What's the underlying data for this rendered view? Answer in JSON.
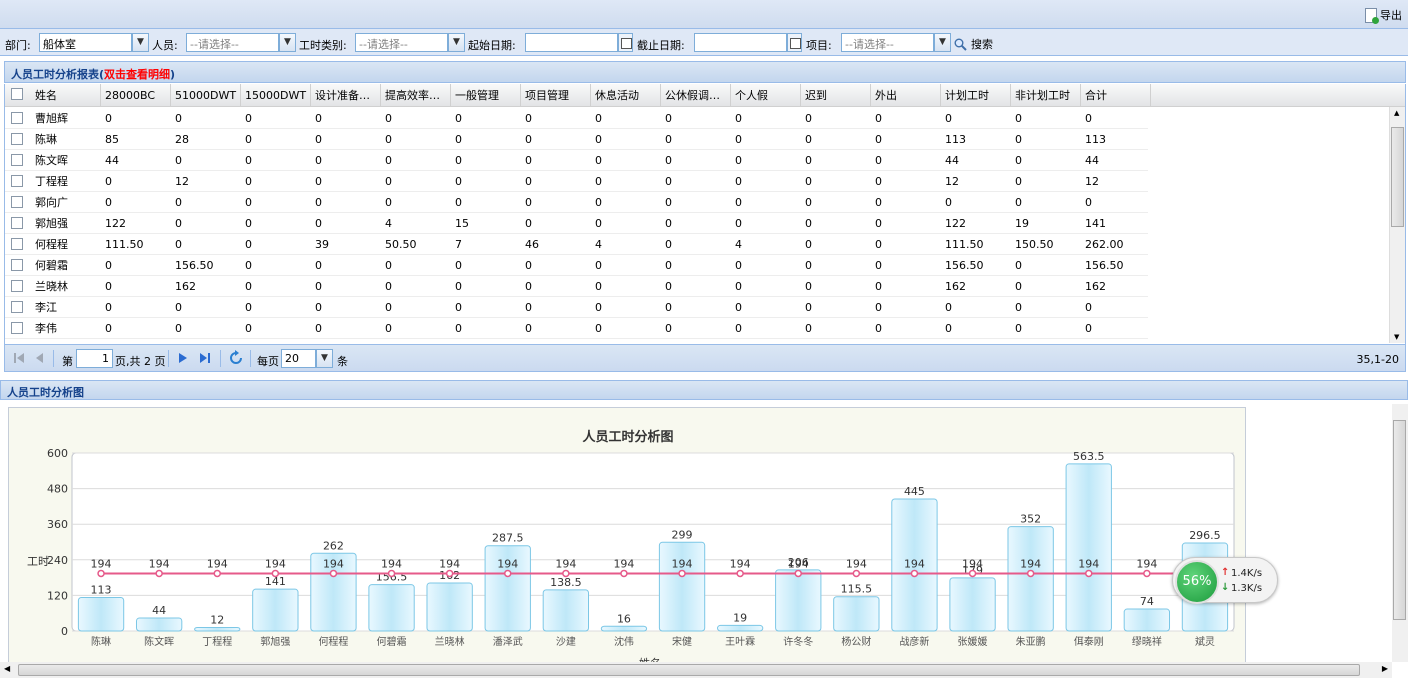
{
  "toolbar": {
    "export_label": "导出"
  },
  "filters": {
    "department_label": "部门:",
    "department_value": "船体室",
    "person_label": "人员:",
    "person_placeholder": "--请选择--",
    "hour_type_label": "工时类别:",
    "hour_type_placeholder": "--请选择--",
    "start_date_label": "起始日期:",
    "start_date_value": "",
    "end_date_label": "截止日期:",
    "end_date_value": "",
    "project_label": "项目:",
    "project_placeholder": "--请选择--",
    "search_label": "搜索"
  },
  "grid": {
    "title": "人员工时分析报表(",
    "title_hint": "双击查看明细",
    "title_close": ")",
    "columns": [
      "姓名",
      "28000BC",
      "51000DWT",
      "15000DWT",
      "设计准备…",
      "提高效率…",
      "一般管理",
      "项目管理",
      "休息活动",
      "公休假调…",
      "个人假",
      "迟到",
      "外出",
      "计划工时",
      "非计划工时",
      "合计"
    ],
    "rows": [
      [
        "曹旭辉",
        "0",
        "0",
        "0",
        "0",
        "0",
        "0",
        "0",
        "0",
        "0",
        "0",
        "0",
        "0",
        "0",
        "0",
        "0"
      ],
      [
        "陈琳",
        "85",
        "28",
        "0",
        "0",
        "0",
        "0",
        "0",
        "0",
        "0",
        "0",
        "0",
        "0",
        "113",
        "0",
        "113"
      ],
      [
        "陈文晖",
        "44",
        "0",
        "0",
        "0",
        "0",
        "0",
        "0",
        "0",
        "0",
        "0",
        "0",
        "0",
        "44",
        "0",
        "44"
      ],
      [
        "丁程程",
        "0",
        "12",
        "0",
        "0",
        "0",
        "0",
        "0",
        "0",
        "0",
        "0",
        "0",
        "0",
        "12",
        "0",
        "12"
      ],
      [
        "郭向广",
        "0",
        "0",
        "0",
        "0",
        "0",
        "0",
        "0",
        "0",
        "0",
        "0",
        "0",
        "0",
        "0",
        "0",
        "0"
      ],
      [
        "郭旭强",
        "122",
        "0",
        "0",
        "0",
        "4",
        "15",
        "0",
        "0",
        "0",
        "0",
        "0",
        "0",
        "122",
        "19",
        "141"
      ],
      [
        "何程程",
        "111.50",
        "0",
        "0",
        "39",
        "50.50",
        "7",
        "46",
        "4",
        "0",
        "4",
        "0",
        "0",
        "111.50",
        "150.50",
        "262.00"
      ],
      [
        "何碧霜",
        "0",
        "156.50",
        "0",
        "0",
        "0",
        "0",
        "0",
        "0",
        "0",
        "0",
        "0",
        "0",
        "156.50",
        "0",
        "156.50"
      ],
      [
        "兰晓林",
        "0",
        "162",
        "0",
        "0",
        "0",
        "0",
        "0",
        "0",
        "0",
        "0",
        "0",
        "0",
        "162",
        "0",
        "162"
      ],
      [
        "李江",
        "0",
        "0",
        "0",
        "0",
        "0",
        "0",
        "0",
        "0",
        "0",
        "0",
        "0",
        "0",
        "0",
        "0",
        "0"
      ],
      [
        "李伟",
        "0",
        "0",
        "0",
        "0",
        "0",
        "0",
        "0",
        "0",
        "0",
        "0",
        "0",
        "0",
        "0",
        "0",
        "0"
      ]
    ]
  },
  "pager": {
    "page_prefix": "第",
    "page_value": "1",
    "page_suffix": "页,共 2 页",
    "per_page_label": "每页",
    "per_page_value": "20",
    "per_page_unit": "条",
    "range_text": "35,1-20"
  },
  "chart_panel": {
    "title": "人员工时分析图"
  },
  "chart_data": {
    "type": "bar",
    "title": "人员工时分析图",
    "ylabel": "工时",
    "xlabel": "姓名",
    "ylim": [
      0,
      600
    ],
    "yticks": [
      0,
      120,
      240,
      360,
      480,
      600
    ],
    "categories": [
      "陈琳",
      "陈文晖",
      "丁程程",
      "郭旭强",
      "何程程",
      "何碧霜",
      "兰晓林",
      "潘泽武",
      "沙建",
      "沈伟",
      "宋健",
      "王叶霖",
      "许冬冬",
      "杨公财",
      "战彦新",
      "张媛媛",
      "朱亚鹏",
      "佴泰刚",
      "缪晓祥",
      "斌灵"
    ],
    "values": [
      113,
      44,
      12,
      141,
      262,
      156.5,
      162,
      287.5,
      138.5,
      16,
      299,
      19,
      206,
      115.5,
      445,
      179,
      352,
      563.5,
      74,
      296.5
    ],
    "series": [
      {
        "type": "bar",
        "values": [
          113,
          44,
          12,
          141,
          262,
          156.5,
          162,
          287.5,
          138.5,
          16,
          299,
          19,
          206,
          115.5,
          445,
          179,
          352,
          563.5,
          74,
          296.5
        ]
      },
      {
        "type": "line",
        "values": [
          194,
          194,
          194,
          194,
          194,
          194,
          194,
          194,
          194,
          194,
          194,
          194,
          194,
          194,
          194,
          194,
          194,
          194,
          194,
          194
        ]
      }
    ],
    "grid": true,
    "colors": {
      "bar": "#bfe8f8",
      "line": "#e65a8a"
    }
  },
  "speed_widget": {
    "percent": "56%",
    "up": "1.4K/s",
    "down": "1.3K/s"
  }
}
